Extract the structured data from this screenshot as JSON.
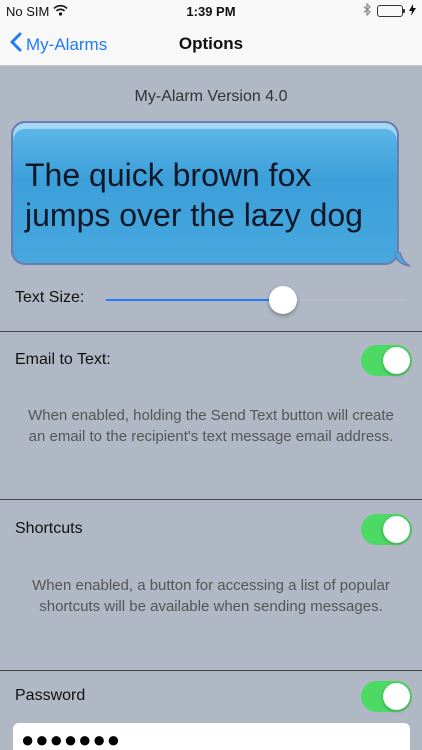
{
  "status_bar": {
    "carrier": "No SIM",
    "time": "1:39 PM"
  },
  "nav": {
    "back_label": "My-Alarms",
    "title": "Options"
  },
  "version_text": "My-Alarm Version 4.0",
  "preview": {
    "line1": "The quick brown fox",
    "line2": "jumps over the lazy dog"
  },
  "text_size": {
    "label": "Text Size:",
    "value_fraction": 0.6
  },
  "email_to_text": {
    "label": "Email to Text:",
    "enabled": true,
    "description": "When enabled, holding the Send Text button will create an email to the recipient's text message email address."
  },
  "shortcuts": {
    "label": "Shortcuts",
    "enabled": true,
    "description": "When enabled, a button for accessing a list of popular shortcuts will be available when sending messages."
  },
  "password": {
    "label": "Password",
    "enabled": true,
    "value": "●●●●●●●"
  },
  "colors": {
    "accent": "#1f7cf6",
    "toggle_on": "#4cd964",
    "background": "#b0b8c6",
    "bubble": "#46a8dd"
  }
}
